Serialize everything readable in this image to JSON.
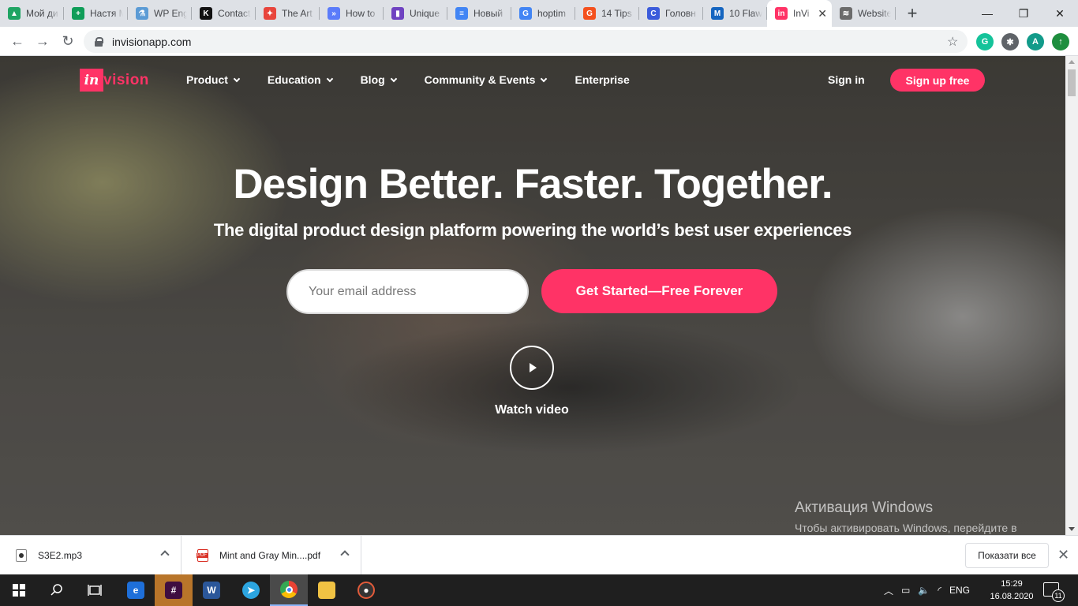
{
  "browser": {
    "tabs": [
      {
        "label": "Мой ди",
        "icon": "google-drive-icon",
        "color": "#1fa463",
        "glyph": "▲"
      },
      {
        "label": "Настя М",
        "icon": "google-sheets-icon",
        "color": "#0f9d58",
        "glyph": "+"
      },
      {
        "label": "WP Eng",
        "icon": "flask-icon",
        "color": "#5b9bd5",
        "glyph": "⚗"
      },
      {
        "label": "Contact",
        "icon": "k-logo-icon",
        "color": "#111111",
        "glyph": "K"
      },
      {
        "label": "The Art",
        "icon": "pinwheel-icon",
        "color": "#e8453c",
        "glyph": "✦"
      },
      {
        "label": "How to",
        "icon": "chevrons-icon",
        "color": "#5b7cfa",
        "glyph": "»"
      },
      {
        "label": "Unique",
        "icon": "bars-icon",
        "color": "#6f42c1",
        "glyph": "▮"
      },
      {
        "label": "Новый",
        "icon": "google-docs-icon",
        "color": "#4285f4",
        "glyph": "≡"
      },
      {
        "label": "hoptim",
        "icon": "google-g-icon",
        "color": "#4285f4",
        "glyph": "G"
      },
      {
        "label": "14 Tips",
        "icon": "g-circle-icon",
        "color": "#f4511e",
        "glyph": "G"
      },
      {
        "label": "Головн",
        "icon": "c-circle-icon",
        "color": "#3b5bdb",
        "glyph": "C"
      },
      {
        "label": "10 Flaw",
        "icon": "m-square-icon",
        "color": "#1565c0",
        "glyph": "M"
      },
      {
        "label": "InVi",
        "icon": "invision-icon",
        "color": "#ff3366",
        "glyph": "in",
        "active": true,
        "close": "✕"
      },
      {
        "label": "Website",
        "icon": "webflow-icon",
        "color": "#6b6b6b",
        "glyph": "≋"
      }
    ],
    "new_tab": "+",
    "window_controls": {
      "minimize": "—",
      "maximize": "❐",
      "close": "✕"
    },
    "url": "invisionapp.com",
    "extensions": [
      {
        "name": "grammarly-icon",
        "glyph": "G",
        "color": "#15c39a"
      },
      {
        "name": "puzzle-icon",
        "glyph": "✱",
        "color": "#5f6368"
      },
      {
        "name": "profile-avatar",
        "glyph": "A",
        "color": "#129b8a"
      },
      {
        "name": "update-icon",
        "glyph": "↑",
        "color": "#1e8e3e"
      }
    ]
  },
  "site": {
    "logo_word": "vision",
    "logo_mark": "in",
    "nav": [
      {
        "label": "Product",
        "dropdown": true
      },
      {
        "label": "Education",
        "dropdown": true
      },
      {
        "label": "Blog",
        "dropdown": true
      },
      {
        "label": "Community & Events",
        "dropdown": true
      },
      {
        "label": "Enterprise",
        "dropdown": false
      }
    ],
    "sign_in": "Sign in",
    "sign_up": "Sign up free",
    "hero": {
      "title": "Design Better. Faster. Together.",
      "subtitle": "The digital product design platform powering the world’s best user experiences",
      "email_placeholder": "Your email address",
      "cta": "Get Started—Free Forever",
      "watch": "Watch video"
    },
    "accent": "#ff3366"
  },
  "windows_watermark": {
    "line1": "Активация Windows",
    "line2": "Чтобы активировать Windows, перейдите в раздел \"Параметры\"."
  },
  "downloads": {
    "items": [
      {
        "name": "S3E2.mp3",
        "type": "mp3"
      },
      {
        "name": "Mint and Gray Min....pdf",
        "type": "pdf"
      }
    ],
    "show_all": "Показати все",
    "close": "✕"
  },
  "taskbar": {
    "language": "ENG",
    "time": "15:29",
    "date": "16.08.2020",
    "notifications": "11"
  }
}
